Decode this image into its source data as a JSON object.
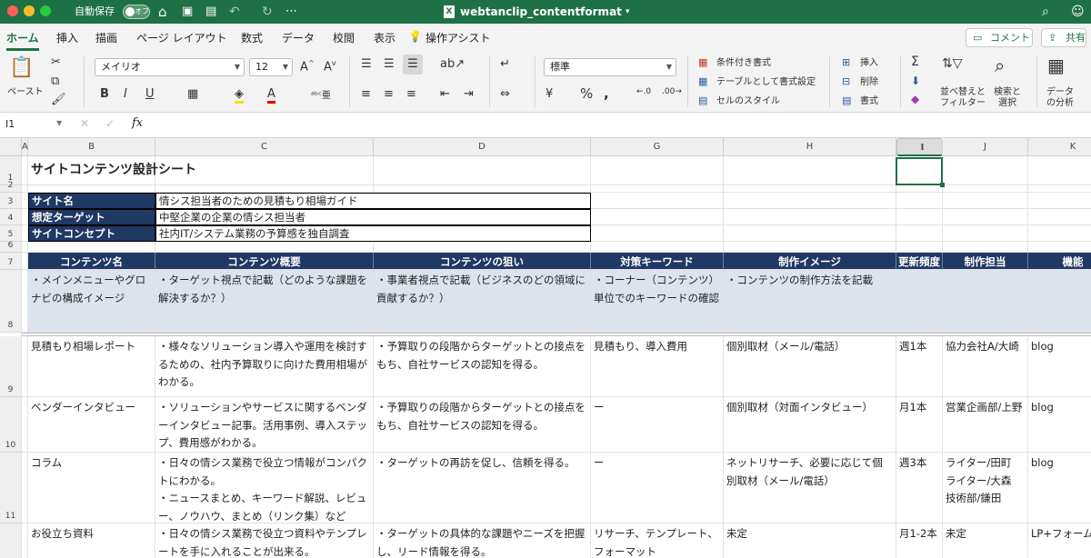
{
  "window": {
    "autosave_label": "自動保存",
    "autosave_state": "オフ",
    "file_title": "webtanclip_contentformat",
    "accent_color": "#1e7145"
  },
  "tabs": [
    "ホーム",
    "挿入",
    "描画",
    "ページ レイアウト",
    "数式",
    "データ",
    "校閲",
    "表示"
  ],
  "tell_me": "操作アシスト",
  "actions": {
    "comment": "コメント",
    "share": "共有"
  },
  "ribbon": {
    "paste": "ペースト",
    "font_name": "メイリオ",
    "font_size": "12",
    "number_format": "標準",
    "cond_format": "条件付き書式",
    "table_format": "テーブルとして書式設定",
    "cell_style": "セルのスタイル",
    "insert": "挿入",
    "delete": "削除",
    "format": "書式",
    "sort_filter_1": "並べ替えと",
    "sort_filter_2": "フィルター",
    "find_select_1": "検索と",
    "find_select_2": "選択",
    "analyze_1": "データ",
    "analyze_2": "の分析"
  },
  "formula_bar": {
    "cell_ref": "I1",
    "fx": "fx",
    "value": ""
  },
  "columns": [
    "A",
    "B",
    "C",
    "D",
    "G",
    "H",
    "I",
    "J",
    "K"
  ],
  "rows": [
    "1",
    "2",
    "3",
    "4",
    "5",
    "6",
    "7",
    "8",
    "9",
    "10",
    "11"
  ],
  "sheet": {
    "title": "サイトコンテンツ設計シート",
    "info": [
      {
        "label": "サイト名",
        "value": "情シス担当者のための見積もり相場ガイド"
      },
      {
        "label": "想定ターゲット",
        "value": "中堅企業の企業の情シス担当者"
      },
      {
        "label": "サイトコンセプト",
        "value": "社内IT/システム業務の予算感を独自調査"
      }
    ],
    "headers": [
      "コンテンツ名",
      "コンテンツ概要",
      "コンテンツの狙い",
      "対策キーワード",
      "制作イメージ",
      "更新頻度",
      "制作担当",
      "機能"
    ],
    "desc_row": [
      "・メインメニューやグロナビの構成イメージ",
      "・ターゲット視点で記載（どのような課題を解決するか？）",
      "・事業者視点で記載（ビジネスのどの領域に貢献するか？）",
      "・コーナー（コンテンツ）単位でのキーワードの確認",
      "・コンテンツの制作方法を記載",
      "",
      "",
      ""
    ],
    "data_rows": [
      [
        "見積もり相場レポート",
        "・様々なソリューション導入や運用を検討するための、社内予算取りに向けた費用相場がわかる。",
        "・予算取りの段階からターゲットとの接点をもち、自社サービスの認知を得る。",
        "見積もり、導入費用",
        "個別取材（メール/電話）",
        "週1本",
        "協力会社A/大崎",
        "blog"
      ],
      [
        "ベンダーインタビュー",
        "・ソリューションやサービスに関するベンダーインタビュー記事。活用事例、導入ステップ、費用感がわかる。",
        "・予算取りの段階からターゲットとの接点をもち、自社サービスの認知を得る。",
        "ー",
        "個別取材（対面インタビュー）",
        "月1本",
        "営業企画部/上野",
        "blog"
      ],
      [
        "コラム",
        "・日々の情シス業務で役立つ情報がコンパクトにわかる。\n・ニュースまとめ、キーワード解説、レビュー、ノウハウ、まとめ（リンク集）など",
        "・ターゲットの再訪を促し、信頼を得る。",
        "ー",
        "ネットリサーチ、必要に応じて個別取材（メール/電話）",
        "週3本",
        "ライター/田町\nライター/大森\n技術部/鎌田",
        "blog"
      ],
      [
        "お役立ち資料",
        "・日々の情シス業務で役立つ資料やテンプレートを手に入れることが出来る。",
        "・ターゲットの具体的な課題やニーズを把握し、リード情報を得る。",
        "リサーチ、テンプレート、フォーマット",
        "未定",
        "月1-2本",
        "未定",
        "LP+フォーム"
      ]
    ]
  }
}
